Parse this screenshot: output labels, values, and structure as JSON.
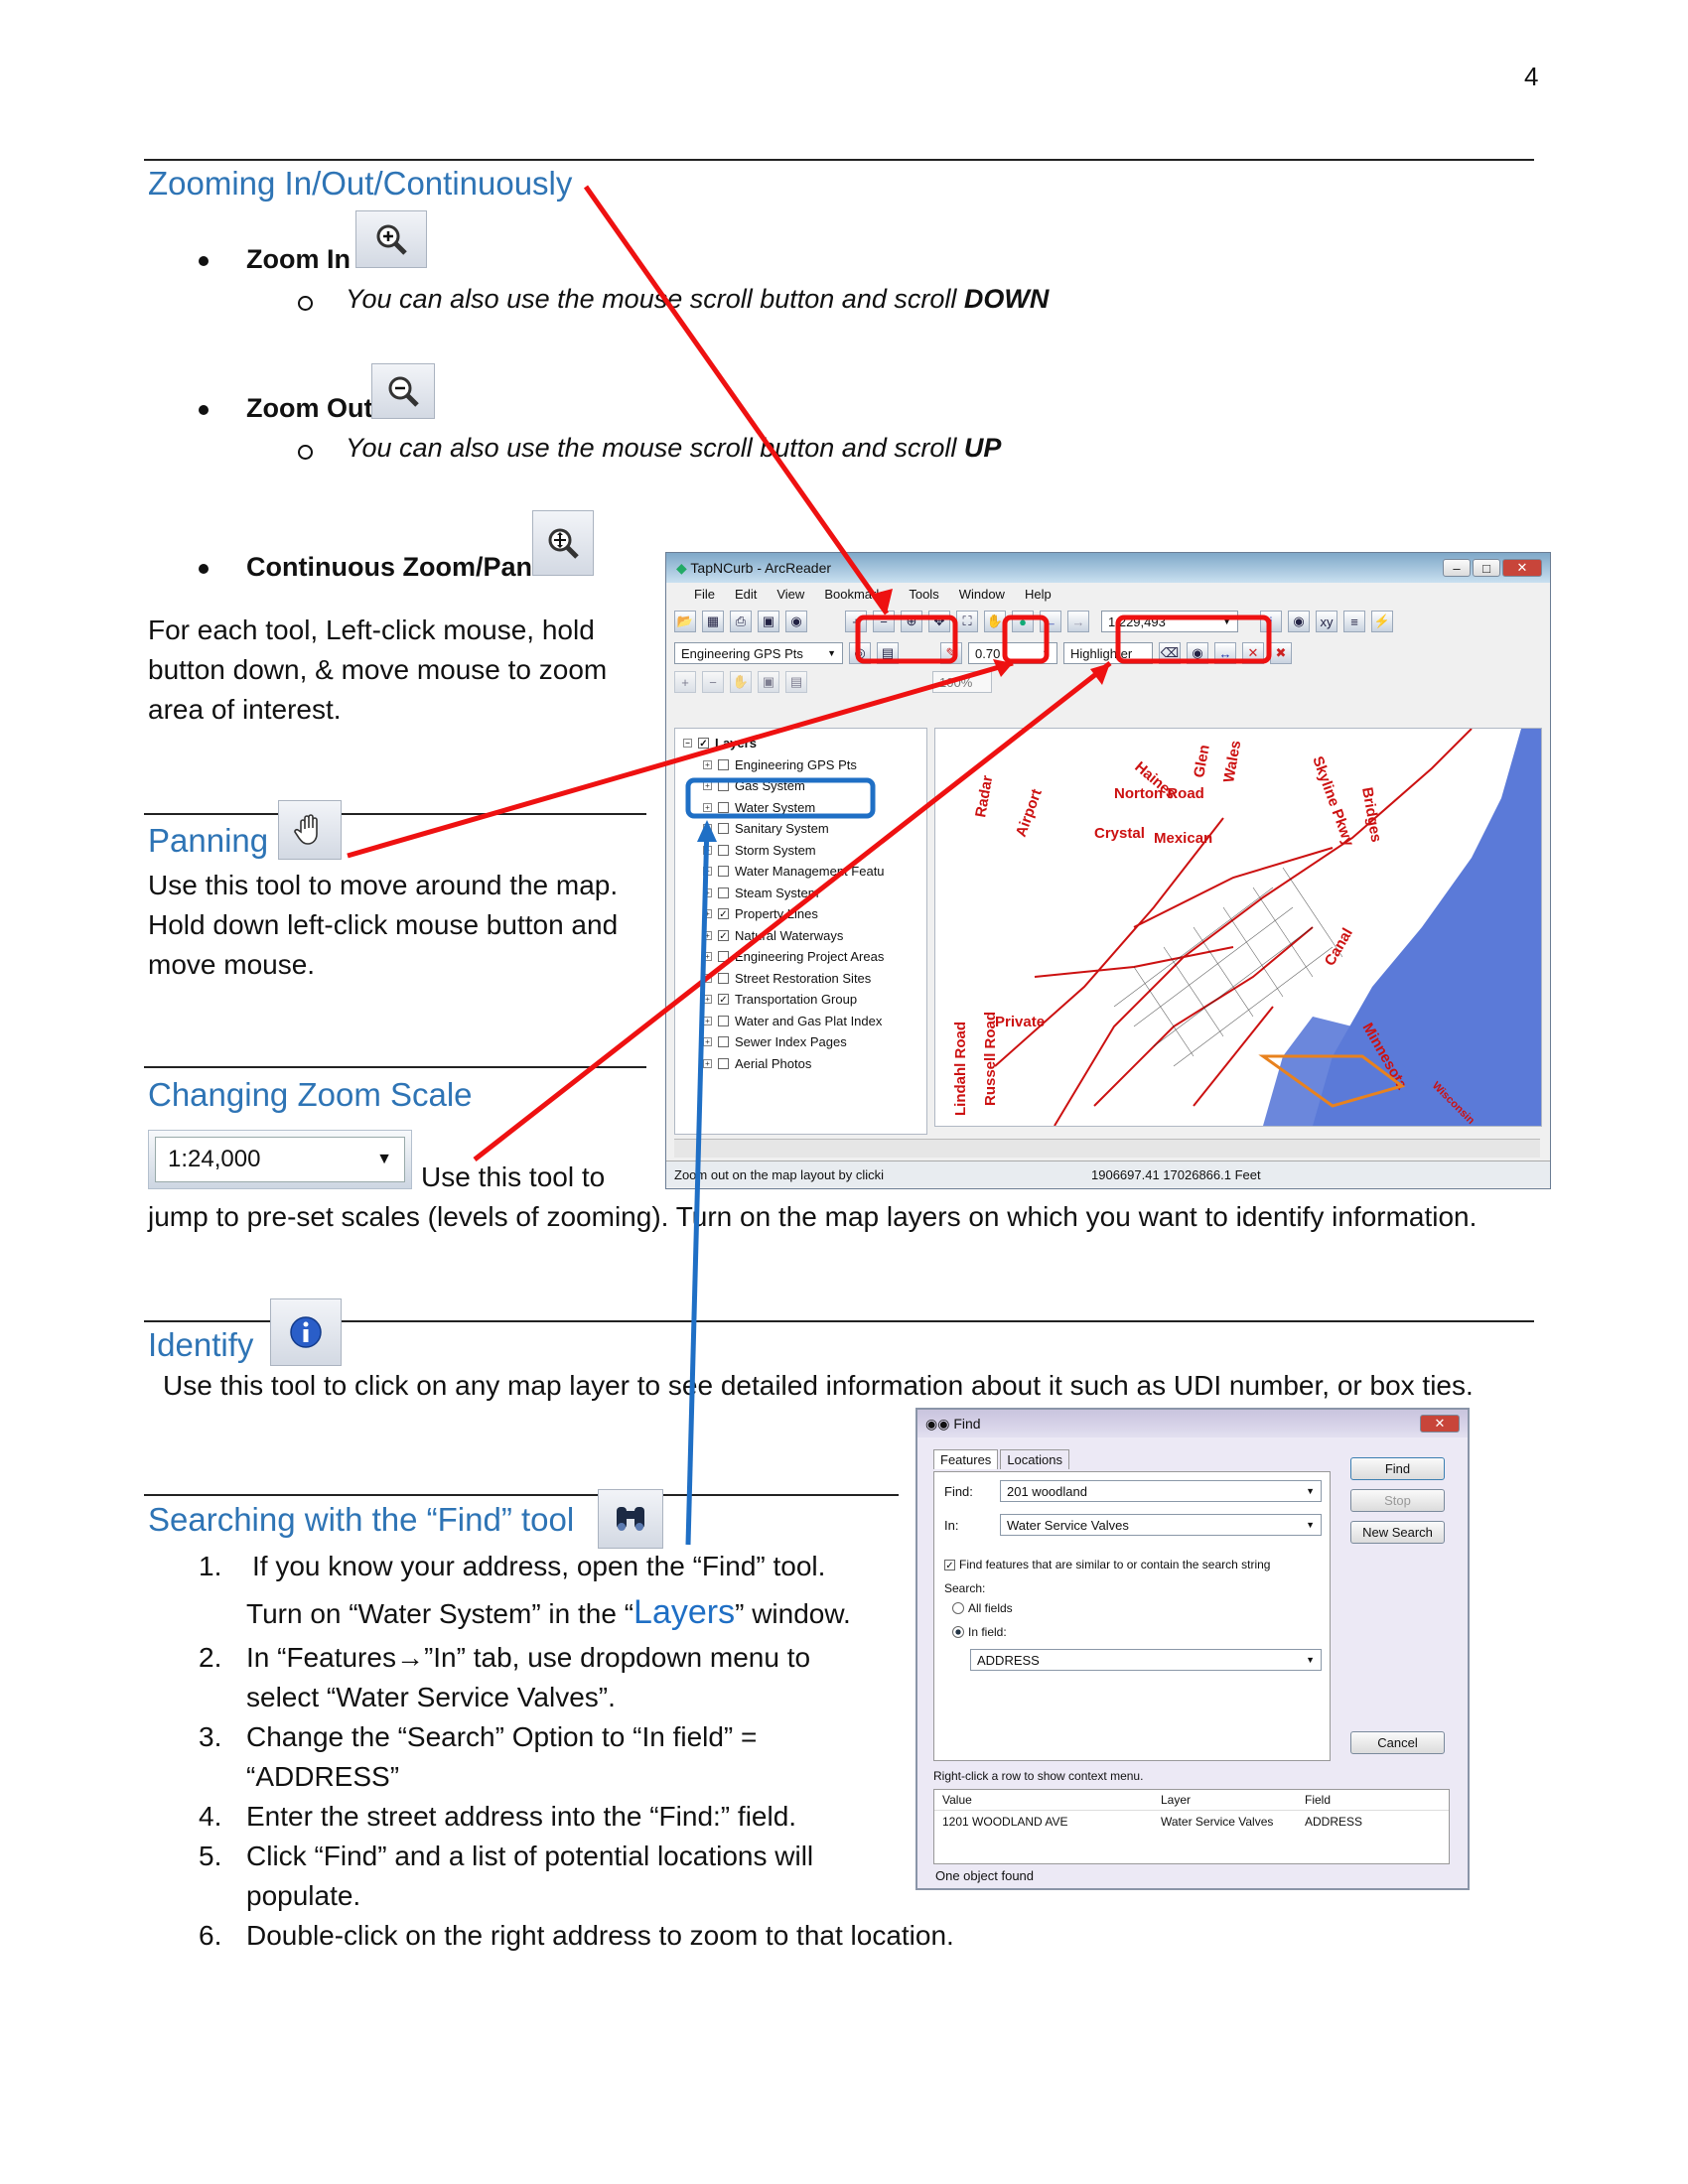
{
  "page_number": "4",
  "zoom": {
    "title": "Zooming In/Out/Continuously",
    "zoom_in": "Zoom In",
    "zoom_in_sub_prefix": "You can also use the mouse scroll button and scroll ",
    "zoom_in_sub_bold": "DOWN",
    "zoom_out": "Zoom Out",
    "zoom_out_sub_prefix": "You can also use the mouse scroll button and scroll ",
    "zoom_out_sub_bold": "UP",
    "continuous": "Continuous Zoom/Pan",
    "description": "For each tool, Left-click mouse, hold button down, & move mouse to zoom area of interest."
  },
  "panning": {
    "title": "Panning",
    "description": "Use this tool to move around the map. Hold down left-click mouse button and move mouse."
  },
  "scale": {
    "title": "Changing Zoom Scale",
    "value": "1:24,000",
    "text_a": "Use this tool to",
    "text_b": "jump to pre-set scales (levels of zooming).  Turn on the map layers on which you want to identify information."
  },
  "identify": {
    "title": "Identify",
    "description": "Use this tool to click on any map layer to see detailed information about it such as UDI number, or box ties."
  },
  "find_section": {
    "title": "Searching with the “Find” tool",
    "step1_a": "If you know your address, open the “Find” tool.",
    "step1_b_pre": "Turn on “Water System” in the “",
    "step1_b_big": "Layers",
    "step1_b_post": "” window.",
    "step2": "In “Features→”In” tab, use dropdown menu to select “Water Service Valves”.",
    "step3": "Change the “Search” Option to “In field” = “ADDRESS”",
    "step4": "Enter the street address into the “Find:” field.",
    "step5": "Click “Find” and a list of potential locations will populate.",
    "step6": "Double-click on the right address to zoom to that location."
  },
  "arcreader": {
    "title": "TapNCurb - ArcReader",
    "menu": [
      "File",
      "Edit",
      "View",
      "Bookmarks",
      "Tools",
      "Window",
      "Help"
    ],
    "scale": "1:229,493",
    "gps_layer": "Engineering GPS Pts",
    "opacity": "0.70",
    "highlighter": "Highlighter",
    "zoom_pct": "100%",
    "toc_root": "Layers",
    "layers": [
      {
        "name": "Engineering GPS Pts",
        "checked": false
      },
      {
        "name": "Gas System",
        "checked": false
      },
      {
        "name": "Water System",
        "checked": false
      },
      {
        "name": "Sanitary System",
        "checked": false
      },
      {
        "name": "Storm System",
        "checked": false
      },
      {
        "name": "Water Management Featu",
        "checked": false
      },
      {
        "name": "Steam System",
        "checked": false
      },
      {
        "name": "Property Lines",
        "checked": true
      },
      {
        "name": "Natural Waterways",
        "checked": true
      },
      {
        "name": "Engineering Project Areas",
        "checked": false
      },
      {
        "name": "Street Restoration Sites",
        "checked": false
      },
      {
        "name": "Transportation Group",
        "checked": true
      },
      {
        "name": "Water and Gas Plat Index",
        "checked": false
      },
      {
        "name": "Sewer Index Pages",
        "checked": false
      },
      {
        "name": "Aerial Photos",
        "checked": false
      }
    ],
    "status_left": "Zoom out on the map layout by clicki",
    "status_coords": "1906697.41  17026866.1 Feet",
    "map_labels": [
      "Norton Road",
      "Canal",
      "Minnesota",
      "Wisconsin",
      "Lindahl Road",
      "Russell Road",
      "Bridges",
      "Skyline Pkwy",
      "Crystal",
      "Mexican",
      "Radar",
      "Airport",
      "Private",
      "Glen",
      "Wales",
      "Haines"
    ]
  },
  "find_dialog": {
    "title": "Find",
    "tab_features": "Features",
    "tab_locations": "Locations",
    "find_label": "Find:",
    "find_value": "201 woodland",
    "in_label": "In:",
    "in_value": "Water Service Valves",
    "similar_label": "Find features that are similar to or contain the search string",
    "search_label": "Search:",
    "all_fields": "All fields",
    "in_field": "In field:",
    "field_value": "ADDRESS",
    "btn_find": "Find",
    "btn_stop": "Stop",
    "btn_new": "New Search",
    "btn_cancel": "Cancel",
    "hint": "Right-click a row to show context menu.",
    "columns": [
      "Value",
      "Layer",
      "Field"
    ],
    "row": [
      "1201 WOODLAND AVE",
      "Water Service Valves",
      "ADDRESS"
    ],
    "status": "One object found"
  },
  "colors": {
    "heading": "#2e74b5",
    "arrow_red": "#ee1111",
    "arrow_blue": "#1f6fc5",
    "water": "#5b7ad8",
    "roads": "#cc1111"
  }
}
